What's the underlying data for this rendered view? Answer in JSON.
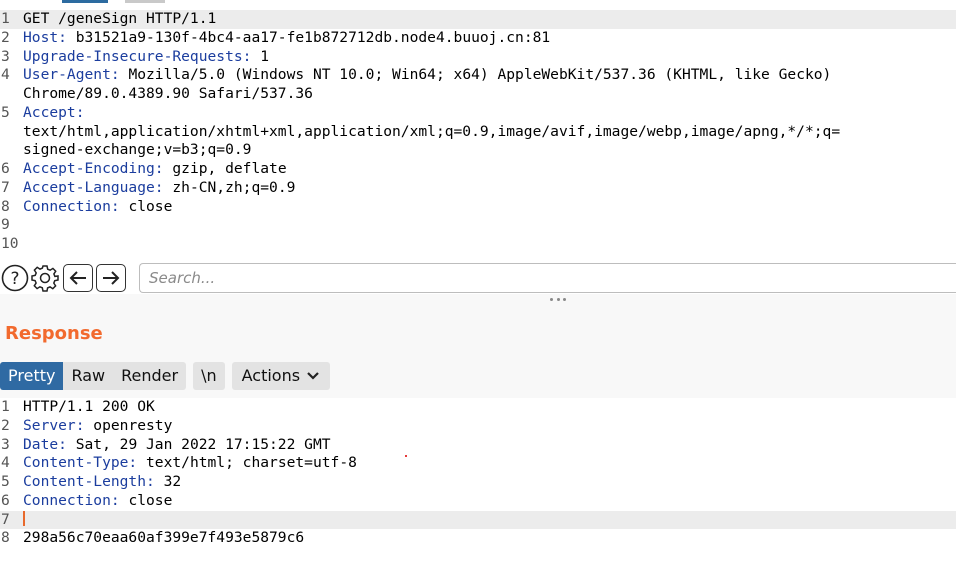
{
  "request": {
    "lines": [
      {
        "num": "1",
        "name": "",
        "value": "GET /geneSign HTTP/1.1"
      },
      {
        "num": "2",
        "name": "Host:",
        "value": " b31521a9-130f-4bc4-aa17-fe1b872712db.node4.buuoj.cn:81"
      },
      {
        "num": "3",
        "name": "Upgrade-Insecure-Requests:",
        "value": " 1"
      },
      {
        "num": "4",
        "name": "User-Agent:",
        "value": " Mozilla/5.0 (Windows NT 10.0; Win64; x64) AppleWebKit/537.36 (KHTML, like Gecko)"
      },
      {
        "num": "",
        "name": "",
        "value": "Chrome/89.0.4389.90 Safari/537.36"
      },
      {
        "num": "5",
        "name": "Accept:",
        "value": ""
      },
      {
        "num": "",
        "name": "",
        "value": "text/html,application/xhtml+xml,application/xml;q=0.9,image/avif,image/webp,image/apng,*/*;q="
      },
      {
        "num": "",
        "name": "",
        "value": "signed-exchange;v=b3;q=0.9"
      },
      {
        "num": "6",
        "name": "Accept-Encoding:",
        "value": " gzip, deflate"
      },
      {
        "num": "7",
        "name": "Accept-Language:",
        "value": " zh-CN,zh;q=0.9"
      },
      {
        "num": "8",
        "name": "Connection:",
        "value": " close"
      },
      {
        "num": "9",
        "name": "",
        "value": ""
      },
      {
        "num": "10",
        "name": "",
        "value": ""
      }
    ]
  },
  "toolbar": {
    "help_icon": "question-circle-icon",
    "settings_icon": "gear-icon",
    "back_icon": "arrow-left-icon",
    "forward_icon": "arrow-right-icon",
    "search_placeholder": "Search..."
  },
  "response": {
    "title": "Response",
    "tabs": {
      "pretty": "Pretty",
      "raw": "Raw",
      "render": "Render",
      "newline": "\\n",
      "actions": "Actions"
    },
    "lines": [
      {
        "num": "1",
        "name": "",
        "value": "HTTP/1.1 200 OK"
      },
      {
        "num": "2",
        "name": "Server:",
        "value": " openresty"
      },
      {
        "num": "3",
        "name": "Date:",
        "value": " Sat, 29 Jan 2022 17:15:22 GMT"
      },
      {
        "num": "4",
        "name": "Content-Type:",
        "value": " text/html; charset=utf-8"
      },
      {
        "num": "5",
        "name": "Content-Length:",
        "value": " 32"
      },
      {
        "num": "6",
        "name": "Connection:",
        "value": " close"
      },
      {
        "num": "7",
        "name": "",
        "value": ""
      },
      {
        "num": "8",
        "name": "",
        "value": "298a56c70eaa60af399e7f493e5879c6"
      }
    ]
  },
  "colors": {
    "accent_orange": "#f26a2e",
    "header_name_blue": "#1b3d9e",
    "active_tab_blue": "#2f6aa3"
  }
}
